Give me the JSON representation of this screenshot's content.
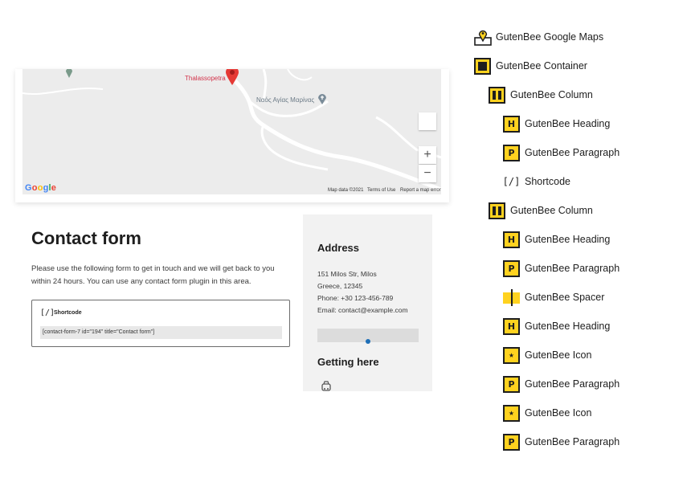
{
  "map": {
    "place_primary": "Thalassopetra",
    "place_secondary": "Ναός Αγίας Μαρίνας",
    "logo": {
      "g1": "G",
      "o1": "o",
      "o2": "o",
      "g2": "g",
      "l": "l",
      "e": "e"
    },
    "zoom_in": "+",
    "zoom_out": "−",
    "footer": {
      "data": "Map data ©2021",
      "terms": "Terms of Use",
      "report": "Report a map error"
    }
  },
  "contact": {
    "title": "Contact form",
    "description": "Please use the following form to get in touch and we will get back to you within 24 hours. You can use any contact form plugin in this area.",
    "shortcode": {
      "icon_glyph": "[/]",
      "label": "Shortcode",
      "value": "[contact-form-7 id=\"194\" title=\"Contact form\"]"
    }
  },
  "address": {
    "title": "Address",
    "lines": [
      "151 Milos Str, Milos",
      "Greece, 12345",
      "Phone: +30 123-456-789",
      "Email: contact@example.com"
    ],
    "getting_here_title": "Getting here"
  },
  "list_view": {
    "items": [
      {
        "label": "GutenBee Google Maps",
        "icon": "map-pin-icon"
      },
      {
        "label": "GutenBee Container",
        "icon": "container-icon"
      },
      {
        "label": "GutenBee Column",
        "icon": "column-icon"
      },
      {
        "label": "GutenBee Heading",
        "icon": "heading-icon",
        "glyph": "H"
      },
      {
        "label": "GutenBee Paragraph",
        "icon": "paragraph-icon",
        "glyph": "P"
      },
      {
        "label": "Shortcode",
        "icon": "shortcode-icon",
        "glyph": "[/]"
      },
      {
        "label": "GutenBee Column",
        "icon": "column-icon"
      },
      {
        "label": "GutenBee Heading",
        "icon": "heading-icon",
        "glyph": "H"
      },
      {
        "label": "GutenBee Paragraph",
        "icon": "paragraph-icon",
        "glyph": "P"
      },
      {
        "label": "GutenBee Spacer",
        "icon": "spacer-icon"
      },
      {
        "label": "GutenBee Heading",
        "icon": "heading-icon",
        "glyph": "H"
      },
      {
        "label": "GutenBee Icon",
        "icon": "star-icon",
        "glyph": "★"
      },
      {
        "label": "GutenBee Paragraph",
        "icon": "paragraph-icon",
        "glyph": "P"
      },
      {
        "label": "GutenBee Icon",
        "icon": "star-icon",
        "glyph": "★"
      },
      {
        "label": "GutenBee Paragraph",
        "icon": "paragraph-icon",
        "glyph": "P"
      }
    ]
  },
  "colors": {
    "accent": "#ffd21f",
    "pin": "#e53935",
    "spacer_dot": "#1e6fb7"
  }
}
